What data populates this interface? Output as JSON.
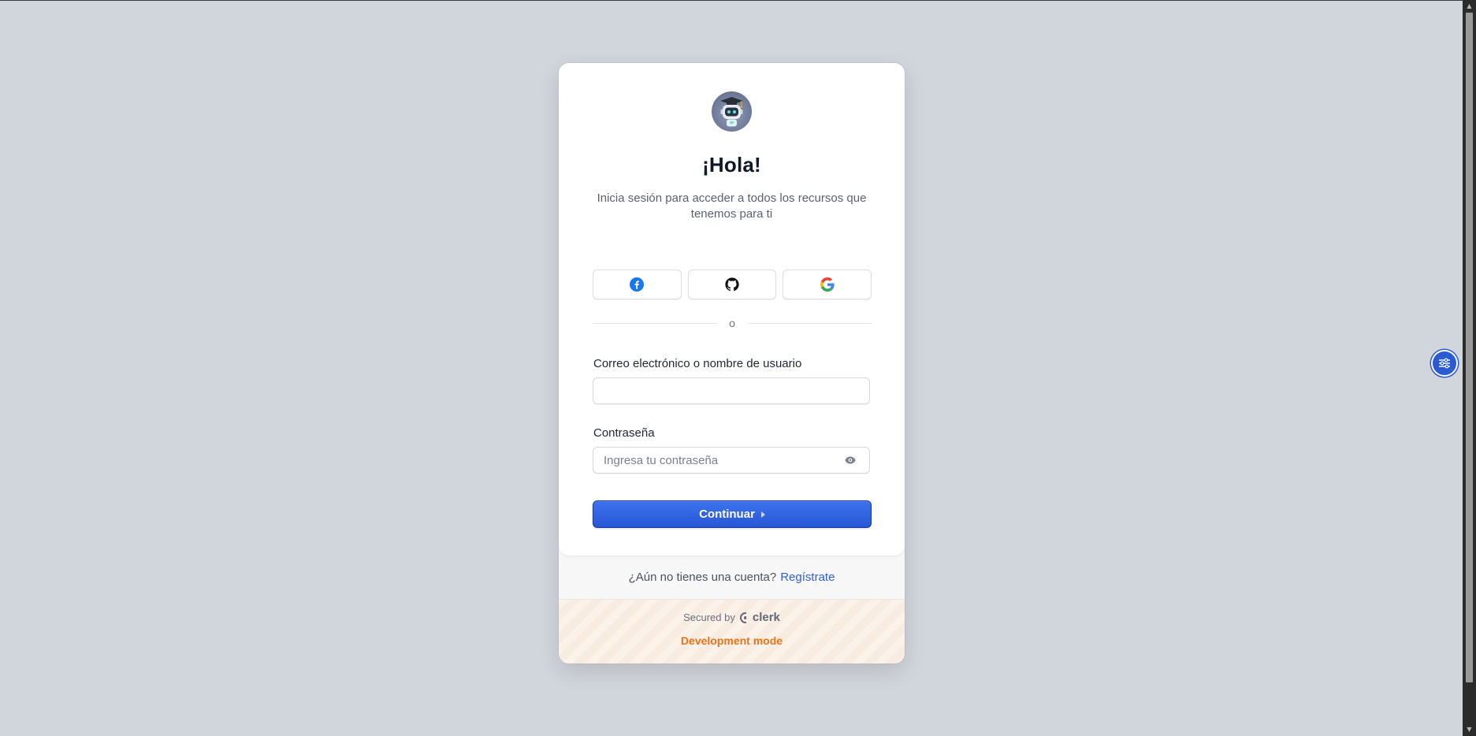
{
  "page": {
    "background": "#d1d5dc"
  },
  "card": {
    "logo_icon": "robot-graduate-avatar",
    "title": "¡Hola!",
    "subtitle": "Inicia sesión para acceder a todos los recursos que tenemos para ti",
    "social": [
      {
        "provider": "facebook",
        "icon": "facebook-icon",
        "color": "#1877f2"
      },
      {
        "provider": "github",
        "icon": "github-icon",
        "color": "#111111"
      },
      {
        "provider": "google",
        "icon": "google-icon",
        "color": "#4285f4"
      }
    ],
    "divider_text": "o",
    "identifier": {
      "label": "Correo electrónico o nombre de usuario",
      "value": "",
      "placeholder": ""
    },
    "password": {
      "label": "Contraseña",
      "value": "",
      "placeholder": "Ingresa tu contraseña",
      "toggle_icon": "eye-icon"
    },
    "continue_label": "Continuar",
    "accent_color": "#2f62de"
  },
  "footer": {
    "signup_prompt": "¿Aún no tienes una cuenta?",
    "signup_link": "Regístrate",
    "secured_by": "Secured by",
    "brand": "clerk",
    "dev_mode": "Development mode",
    "dev_mode_color": "#e8731a"
  },
  "floating_button": {
    "icon": "sliders-icon",
    "color": "#2a5ad4"
  }
}
